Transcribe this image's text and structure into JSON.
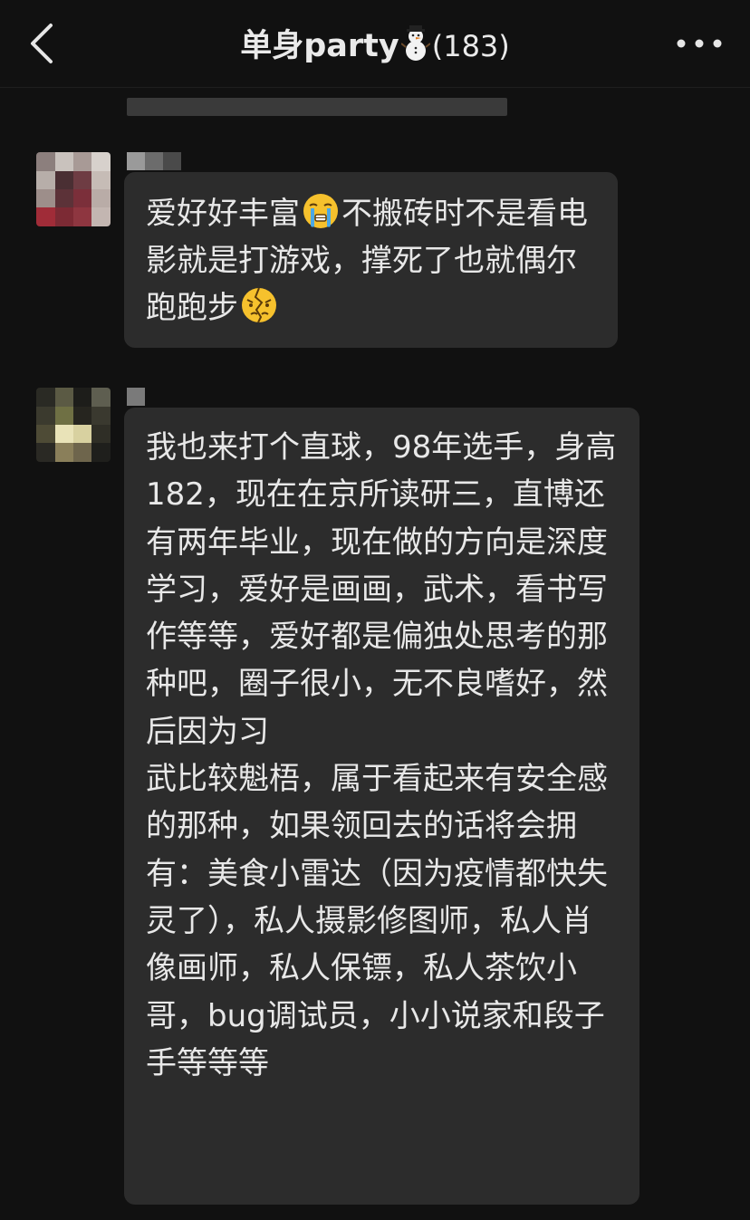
{
  "header": {
    "title": "单身party",
    "member_count": "(183)",
    "snowman_icon": "snowman-emoji",
    "back_icon": "chevron-left-icon",
    "more_icon": "more-dots-icon"
  },
  "messages": [
    {
      "sender": "",
      "parts": [
        "爱好好丰富",
        "不搬砖时不是看电影就是打游戏，撑死了也就偶尔跑跑步",
        ""
      ],
      "emojis": [
        "crying-face-emoji",
        "broken-face-emoji"
      ]
    },
    {
      "sender": "",
      "text": "我也来打个直球，98年选手，身高182，现在在京所读研三，直博还有两年毕业，现在做的方向是深度学习，爱好是画画，武术，看书写作等等，爱好都是偏独处思考的那种吧，圈子很小，无不良嗜好，然后因为习\n武比较魁梧，属于看起来有安全感的那种，如果领回去的话将会拥有：美食小雷达（因为疫情都快失灵了），私人摄影修图师，私人肖像画师，私人保镖，私人茶饮小哥，bug调试员，小小说家和段子手等等等"
    }
  ],
  "colors": {
    "background": "#111111",
    "bubble": "#2c2c2c",
    "text": "#e8e8e8"
  }
}
